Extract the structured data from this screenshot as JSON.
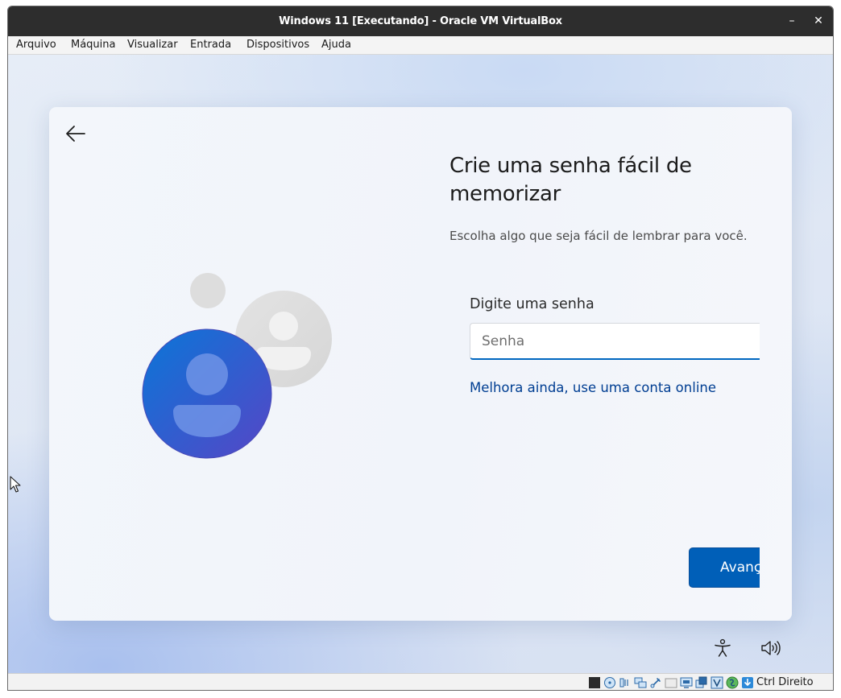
{
  "window": {
    "title": "Windows 11 [Executando] - Oracle VM VirtualBox",
    "minimize_glyph": "–",
    "close_glyph": "✕"
  },
  "menubar": {
    "items": [
      "Arquivo",
      "Máquina",
      "Visualizar",
      "Entrada",
      "Dispositivos",
      "Ajuda"
    ]
  },
  "oobe": {
    "heading": "Crie uma senha fácil de memorizar",
    "subtitle": "Escolha algo que seja fácil de lembrar para você.",
    "field_label": "Digite uma senha",
    "password_placeholder": "Senha",
    "password_value": "",
    "online_link": "Melhora ainda, use uma conta online",
    "next_button": "Avançar"
  },
  "taskbar": {
    "icons": [
      "accessibility-icon",
      "volume-icon"
    ]
  },
  "statusbar": {
    "icons": [
      "display-icon",
      "optical-drive-icon",
      "audio-icon",
      "network-icon",
      "usb-icon",
      "shared-folders-icon",
      "screen-icon",
      "recording-icon",
      "virtualization-icon",
      "mouse-integration-icon",
      "download-icon"
    ],
    "host_key": "Ctrl Direito"
  },
  "colors": {
    "accent": "#005fb8",
    "link": "#003e92",
    "titlebar": "#2d2d2d"
  }
}
